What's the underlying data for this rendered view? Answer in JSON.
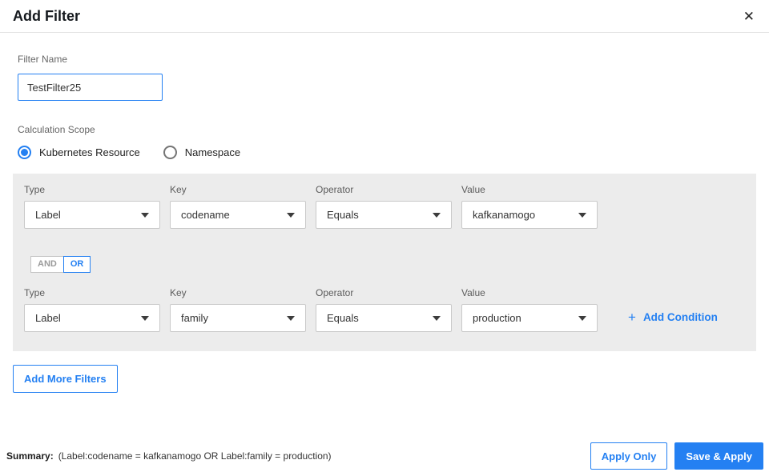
{
  "header": {
    "title": "Add Filter",
    "close_icon": "✕"
  },
  "filter_name": {
    "label": "Filter Name",
    "value": "TestFilter25"
  },
  "calculation_scope": {
    "label": "Calculation Scope",
    "options": [
      {
        "label": "Kubernetes Resource",
        "selected": true
      },
      {
        "label": "Namespace",
        "selected": false
      }
    ]
  },
  "conditions": {
    "logic_toggle": {
      "and_label": "AND",
      "or_label": "OR",
      "selected": "OR"
    },
    "plus_icon": "+",
    "add_condition_label": "Add Condition",
    "rows": [
      {
        "fields": [
          {
            "label": "Type",
            "value": "Label"
          },
          {
            "label": "Key",
            "value": "codename"
          },
          {
            "label": "Operator",
            "value": "Equals"
          },
          {
            "label": "Value",
            "value": "kafkanamogo"
          }
        ]
      },
      {
        "fields": [
          {
            "label": "Type",
            "value": "Label"
          },
          {
            "label": "Key",
            "value": "family"
          },
          {
            "label": "Operator",
            "value": "Equals"
          },
          {
            "label": "Value",
            "value": "production"
          }
        ]
      }
    ]
  },
  "add_more_filters_label": "Add More Filters",
  "footer": {
    "summary_label": "Summary:",
    "summary_text": "(Label:codename = kafkanamogo OR Label:family = production)",
    "apply_only_label": "Apply Only",
    "save_apply_label": "Save & Apply"
  },
  "colors": {
    "accent": "#2480f2",
    "panel_bg": "#ececec"
  }
}
